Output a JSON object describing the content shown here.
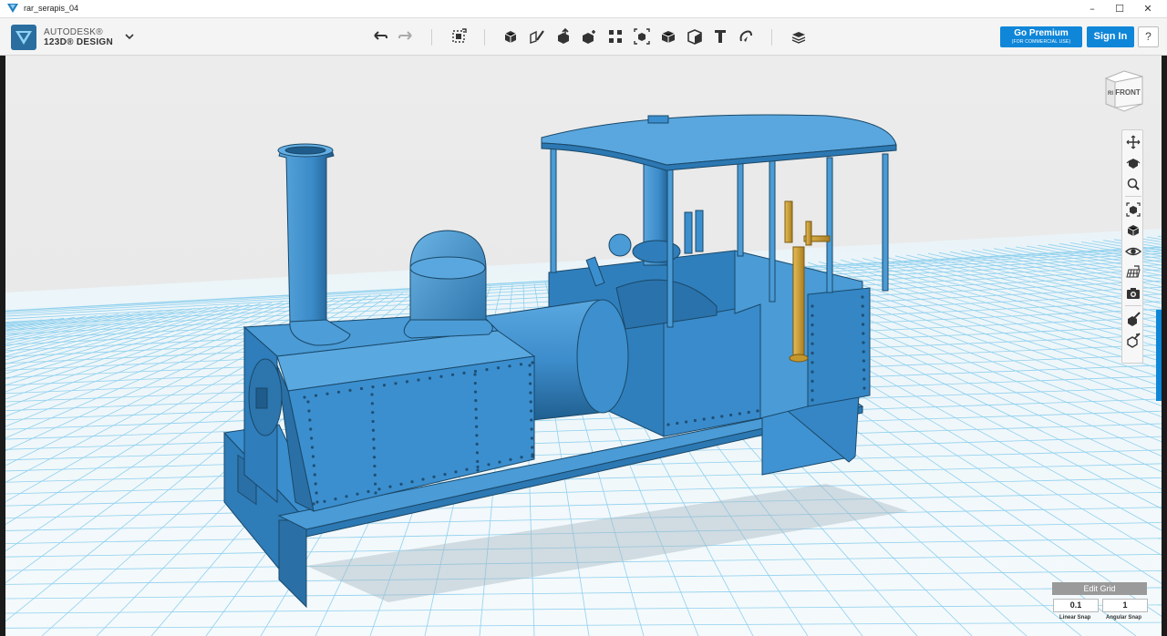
{
  "window": {
    "title": "rar_serapis_04",
    "minimize_glyph": "–",
    "maximize_glyph": "☐",
    "close_glyph": "✕"
  },
  "brand": {
    "line1": "AUTODESK®",
    "line2": "123D® DESIGN"
  },
  "toolbar": {
    "icons": [
      "undo-icon",
      "redo-icon",
      "transform-icon",
      "primitives-icon",
      "sketch-icon",
      "construct-icon",
      "modify-icon",
      "pattern-icon",
      "group-icon",
      "combine-icon",
      "measure-icon",
      "text-icon",
      "snap-icon",
      "material-icon"
    ]
  },
  "account": {
    "premium_label": "Go Premium",
    "premium_sub": "(FOR COMMERCIAL USE)",
    "signin_label": "Sign In",
    "help_label": "?"
  },
  "viewcube": {
    "face_front": "FRONT",
    "face_right": "RI"
  },
  "nav": {
    "icons": [
      "pan-icon",
      "orbit-icon",
      "zoom-icon",
      "fit-icon",
      "view-mode-icon",
      "visibility-icon",
      "grid-icon",
      "camera-icon",
      "material-icon",
      "outline-icon"
    ]
  },
  "grid": {
    "edit_label": "Edit Grid",
    "linear_snap_value": "0.1",
    "linear_snap_label": "Linear Snap",
    "angular_snap_value": "1",
    "angular_snap_label": "Angular Snap"
  },
  "colors": {
    "accent": "#0f86d8",
    "model": "#3b8fcf",
    "grid_line": "#8fd0ee",
    "brass": "#d4a537"
  }
}
